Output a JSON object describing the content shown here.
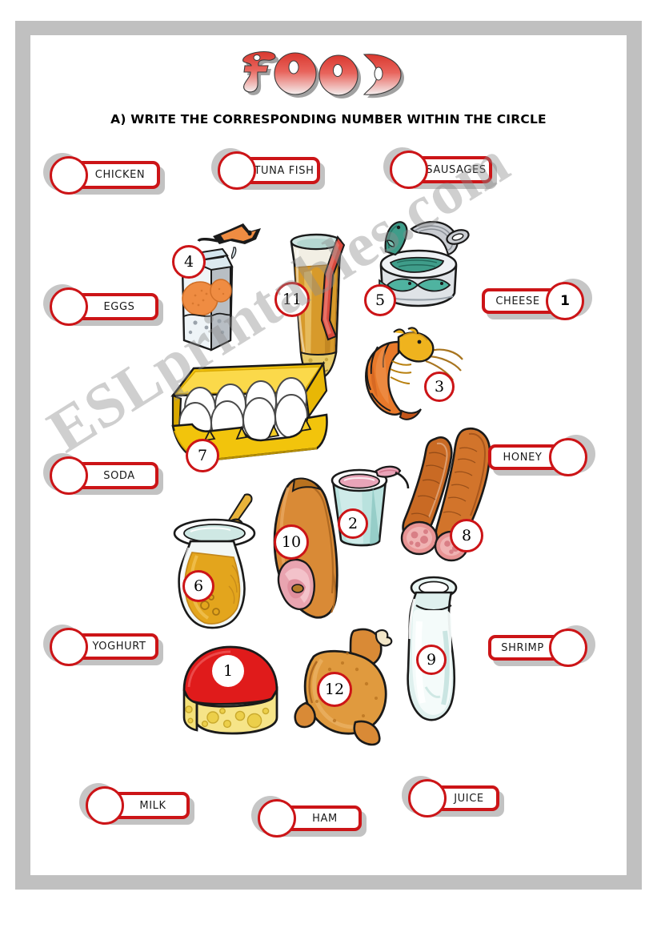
{
  "title": {
    "text": "FOOD"
  },
  "instruction": {
    "text": "A)  WRITE THE CORRESPONDING NUMBER WITHIN THE CIRCLE"
  },
  "watermark": {
    "text": "ESLprintables.com"
  },
  "colors": {
    "chip_border": "#cc1417",
    "page_frame": "#c0c0c0",
    "page_background": "#ffffff",
    "text": "#000000",
    "title_gradient_from": "#e03a33",
    "title_gradient_to": "#f6f2f2"
  },
  "word_bank": [
    {
      "label": "CHICKEN",
      "answer": "",
      "circle_side": "left"
    },
    {
      "label": "TUNA FISH",
      "answer": "",
      "circle_side": "left"
    },
    {
      "label": "SAUSAGES",
      "answer": "",
      "circle_side": "left"
    },
    {
      "label": "EGGS",
      "answer": "",
      "circle_side": "left"
    },
    {
      "label": "CHEESE",
      "answer": "1",
      "circle_side": "right"
    },
    {
      "label": "SODA",
      "answer": "",
      "circle_side": "left"
    },
    {
      "label": "HONEY",
      "answer": "",
      "circle_side": "right"
    },
    {
      "label": "YOGHURT",
      "answer": "",
      "circle_side": "left"
    },
    {
      "label": "SHRIMP",
      "answer": "",
      "circle_side": "right"
    },
    {
      "label": "MILK",
      "answer": "",
      "circle_side": "left"
    },
    {
      "label": "HAM",
      "answer": "",
      "circle_side": "left"
    },
    {
      "label": "JUICE",
      "answer": "",
      "circle_side": "left"
    }
  ],
  "picture_numbers": [
    {
      "number": "4",
      "item": "juice-carton"
    },
    {
      "number": "11",
      "item": "soda-glass"
    },
    {
      "number": "5",
      "item": "tuna-can"
    },
    {
      "number": "3",
      "item": "shrimp"
    },
    {
      "number": "7",
      "item": "egg-carton"
    },
    {
      "number": "2",
      "item": "yoghurt-cup"
    },
    {
      "number": "8",
      "item": "sausages"
    },
    {
      "number": "6",
      "item": "honey-jar"
    },
    {
      "number": "10",
      "item": "ham-leg"
    },
    {
      "number": "1",
      "item": "cheese-wheel"
    },
    {
      "number": "12",
      "item": "roast-chicken"
    },
    {
      "number": "9",
      "item": "milk-bottle"
    }
  ]
}
